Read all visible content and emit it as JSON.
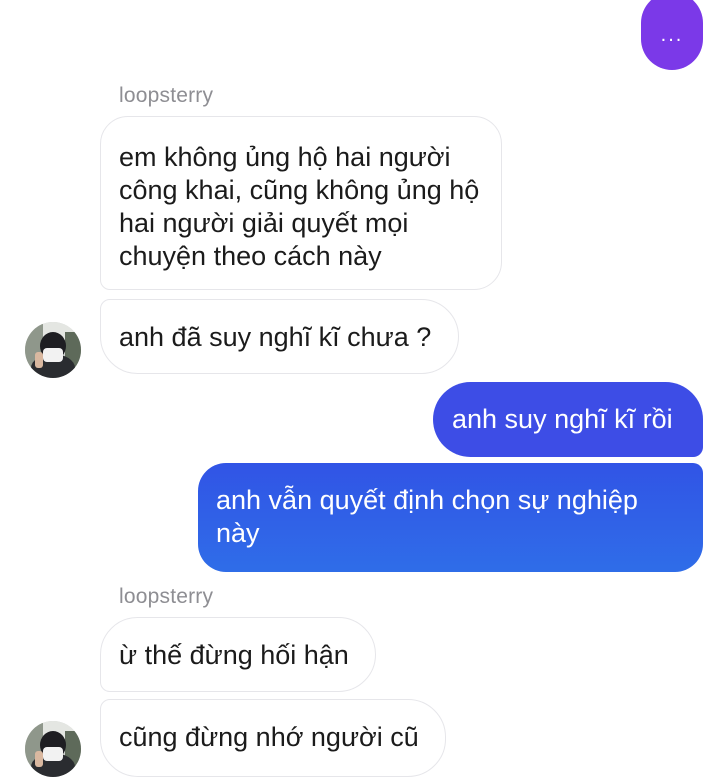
{
  "top_bubble": {
    "label": "..."
  },
  "colors": {
    "outgoing_top": "#3d4de6",
    "outgoing_bottom": "#2f6de8",
    "more_bubble": "#7b39e8",
    "incoming_border": "#e6e6ea"
  },
  "thread": {
    "group1": {
      "sender": "loopsterry",
      "messages": [
        "em không ủng hộ hai người công khai, cũng không ủng hộ hai người giải quyết mọi chuyện theo cách này",
        "anh đã suy nghĩ kĩ chưa ?"
      ]
    },
    "outgoing": {
      "messages": [
        "anh suy nghĩ kĩ rồi",
        "anh vẫn quyết định chọn sự nghiệp này"
      ]
    },
    "group2": {
      "sender": "loopsterry",
      "messages": [
        "ừ thế đừng hối hận",
        "cũng đừng nhớ người cũ"
      ]
    }
  },
  "avatar_icon": "user-avatar-photo"
}
